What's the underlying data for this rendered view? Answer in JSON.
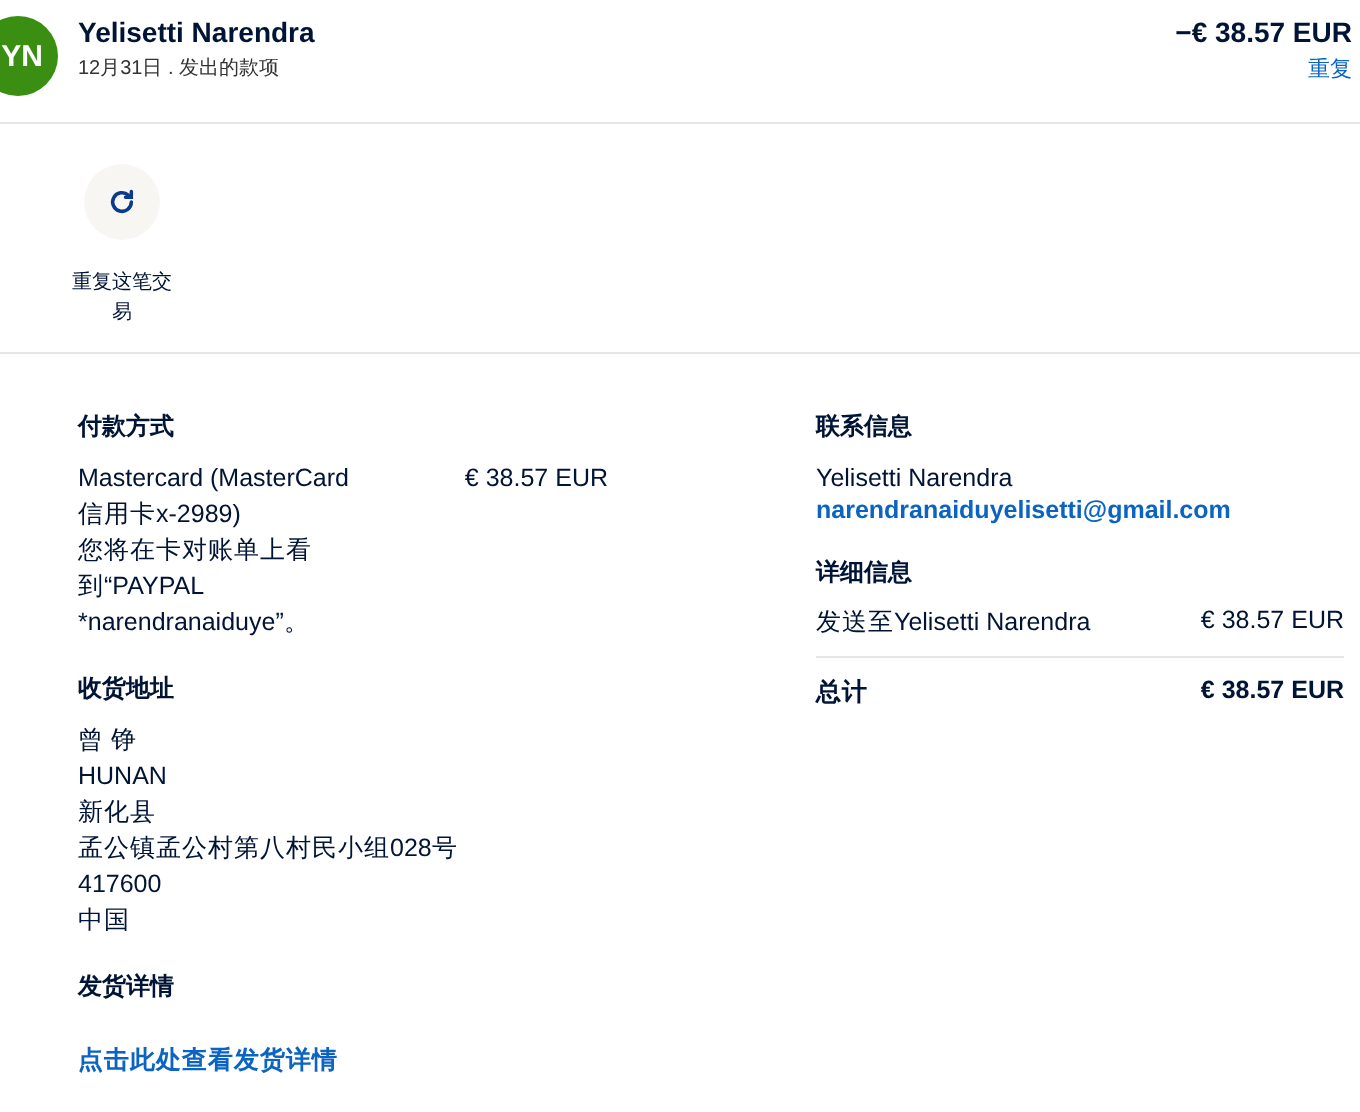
{
  "header": {
    "avatar": "YN",
    "name": "Yelisetti Narendra",
    "subtitle": "12月31日 . 发出的款项",
    "amount": "−€ 38.57 EUR",
    "repeat_link": "重复"
  },
  "actions": [
    {
      "label": "重复这笔交易"
    }
  ],
  "payment": {
    "title": "付款方式",
    "method": "Mastercard (MasterCard信用卡x-2989)",
    "note": "您将在卡对账单上看到“PAYPAL *narendranaiduye”。",
    "amount": "€ 38.57 EUR"
  },
  "shipping_address": {
    "title": "收货地址",
    "lines": [
      "曾 铮",
      "HUNAN",
      "新化县",
      "孟公镇孟公村第八村民小组028号",
      "417600",
      "中国"
    ]
  },
  "shipping_details": {
    "title": "发货详情",
    "link": "点击此处查看发货详情"
  },
  "contact": {
    "title": "联系信息",
    "name": "Yelisetti Narendra",
    "email": "narendranaiduyelisetti@gmail.com"
  },
  "details": {
    "title": "详细信息",
    "rows": [
      {
        "kind": "item",
        "label": "发送至Yelisetti Narendra",
        "value": "€ 38.57 EUR"
      },
      {
        "kind": "total",
        "label": "总计",
        "value": "€ 38.57 EUR"
      }
    ]
  }
}
